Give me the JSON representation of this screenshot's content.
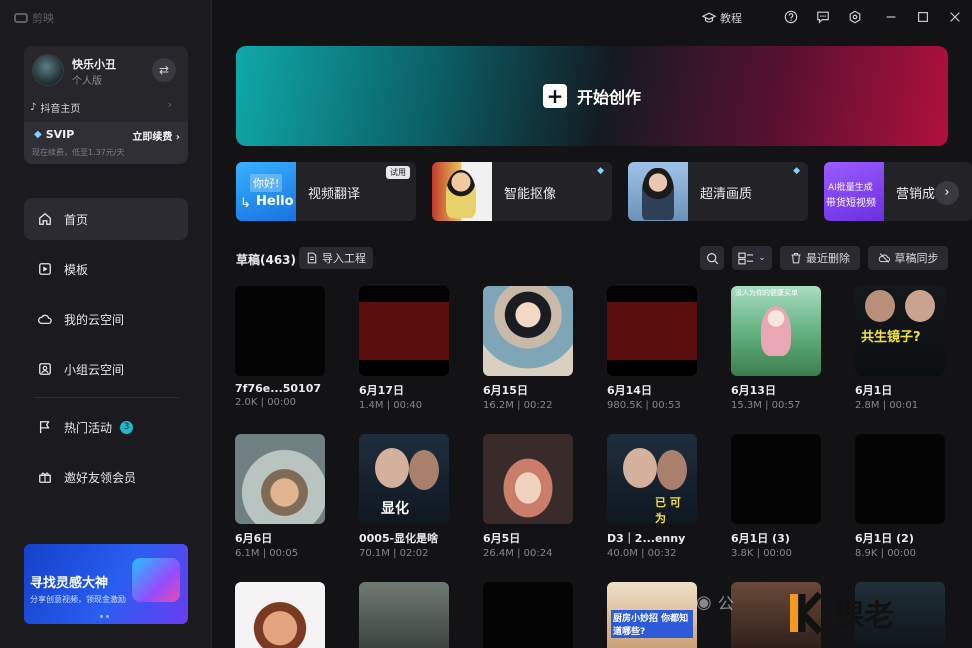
{
  "app": {
    "logo_text": "剪映"
  },
  "user": {
    "name": "快乐小丑",
    "subtitle": "个人版",
    "douyin": "抖音主页",
    "svip": "SVIP",
    "renew": "立即续费",
    "note": "现在续费，低至1.37元/天"
  },
  "nav": [
    {
      "label": "首页",
      "icon": "home-icon"
    },
    {
      "label": "模板",
      "icon": "template-icon"
    },
    {
      "label": "我的云空间",
      "icon": "cloud-icon"
    },
    {
      "label": "小组云空间",
      "icon": "team-cloud-icon"
    },
    {
      "label": "热门活动",
      "icon": "flag-icon",
      "badge": "3"
    },
    {
      "label": "邀好友领会员",
      "icon": "gift-icon"
    }
  ],
  "promo": {
    "title": "寻找灵感大神",
    "subtitle": "分享创意视频，领现金激励"
  },
  "titlebar": {
    "tutorial": "教程"
  },
  "hero": {
    "label": "开始创作"
  },
  "tools": [
    {
      "label": "视频翻译",
      "tag": "试用",
      "thumb_text_1": "你好!",
      "thumb_text_2": "Hello"
    },
    {
      "label": "智能抠像"
    },
    {
      "label": "超清画质"
    },
    {
      "label": "营销成",
      "thumb_text_1": "AI批量生成",
      "thumb_text_2": "带货短视频"
    }
  ],
  "drafts": {
    "title": "草稿(463)",
    "import": "导入工程",
    "recent_delete": "最近删除",
    "sync": "草稿同步",
    "items": [
      {
        "name": "7f76e...50107",
        "meta": "2.0K | 00:00"
      },
      {
        "name": "6月17日",
        "meta": "1.4M | 00:40"
      },
      {
        "name": "6月15日",
        "meta": "16.2M | 00:22"
      },
      {
        "name": "6月14日",
        "meta": "980.5K | 00:53"
      },
      {
        "name": "6月13日",
        "meta": "15.3M | 00:57"
      },
      {
        "name": "6月1日",
        "meta": "2.8M | 00:01"
      },
      {
        "name": "6月6日",
        "meta": "6.1M | 00:05"
      },
      {
        "name": "0005-显化是啥",
        "meta": "70.1M | 02:02"
      },
      {
        "name": "6月5日",
        "meta": "26.4M | 00:24"
      },
      {
        "name": "D3｜2...enny",
        "meta": "40.0M | 00:32"
      },
      {
        "name": "6月1日 (3)",
        "meta": "3.8K | 00:00"
      },
      {
        "name": "6月1日 (2)",
        "meta": "8.9K | 00:00"
      }
    ],
    "thumb_texts": {
      "d4": "没人为你的健康买单",
      "d5": "共生镜子?",
      "d7": "显化",
      "d9": "已 可为",
      "r3": "厨房小妙招 你都知道哪些?"
    }
  },
  "watermark": {
    "text": "公",
    "brand": "课老"
  }
}
